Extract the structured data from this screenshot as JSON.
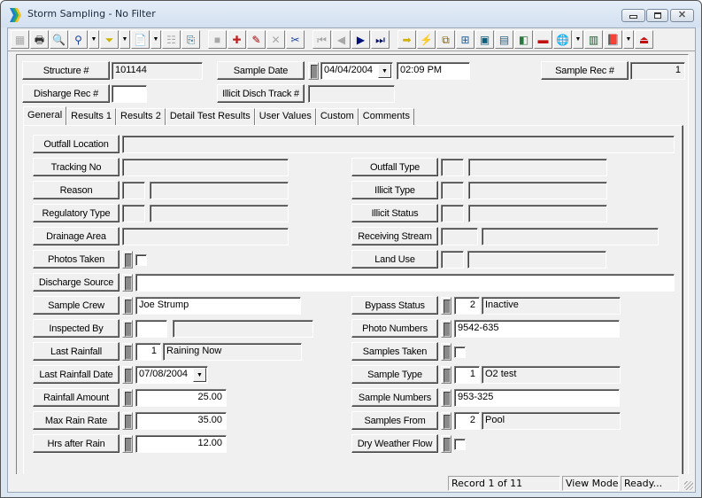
{
  "window": {
    "title": "Storm Sampling - No Filter",
    "buttons": {
      "minimize": "minimize",
      "maximize": "maximize",
      "close": "✕"
    }
  },
  "toolbar": {
    "items": [
      {
        "icon": "form-view-icon",
        "glyph": "▦",
        "disabled": true
      },
      {
        "icon": "print-icon",
        "glyph": "🖶"
      },
      {
        "icon": "print-preview-icon",
        "glyph": "🔍"
      },
      {
        "icon": "find-binoculars-icon",
        "glyph": "⚲"
      },
      {
        "icon": "find-dropdown-icon",
        "glyph": "▼",
        "dropdown": true
      },
      {
        "icon": "filter-funnel-icon",
        "glyph": "⏷"
      },
      {
        "icon": "filter-dropdown-icon",
        "glyph": "▼",
        "dropdown": true
      },
      {
        "icon": "report-icon",
        "glyph": "📄"
      },
      {
        "icon": "report-dropdown-icon",
        "glyph": "▼",
        "dropdown": true
      },
      {
        "icon": "properties-icon",
        "glyph": "☷",
        "disabled": true
      },
      {
        "icon": "copy-record-icon",
        "glyph": "⎘"
      },
      {
        "icon": "save-icon",
        "glyph": "■",
        "disabled": true
      },
      {
        "icon": "add-record-icon",
        "glyph": "✚"
      },
      {
        "icon": "edit-pencil-icon",
        "glyph": "✎"
      },
      {
        "icon": "delete-icon",
        "glyph": "✕",
        "disabled": true
      },
      {
        "icon": "cut-scissors-icon",
        "glyph": "✂"
      },
      {
        "icon": "first-record-icon",
        "glyph": "⏮",
        "disabled": true
      },
      {
        "icon": "previous-record-icon",
        "glyph": "◀",
        "disabled": true
      },
      {
        "icon": "next-record-icon",
        "glyph": "▶"
      },
      {
        "icon": "last-record-icon",
        "glyph": "⏭"
      },
      {
        "icon": "goto-arrow-icon",
        "glyph": "➡"
      },
      {
        "icon": "lightning-icon",
        "glyph": "⚡"
      },
      {
        "icon": "related-records-icon",
        "glyph": "⧉"
      },
      {
        "icon": "link-icon",
        "glyph": "⊞"
      },
      {
        "icon": "map-icon",
        "glyph": "▣"
      },
      {
        "icon": "calculator-icon",
        "glyph": "▤"
      },
      {
        "icon": "gis-icon",
        "glyph": "◧"
      },
      {
        "icon": "toolbox-icon",
        "glyph": "▬"
      },
      {
        "icon": "globe-search-icon",
        "glyph": "🌐"
      },
      {
        "icon": "globe-dropdown-icon",
        "glyph": "▼",
        "dropdown": true
      },
      {
        "icon": "spreadsheet-icon",
        "glyph": "▥"
      },
      {
        "icon": "help-book-icon",
        "glyph": "📕"
      },
      {
        "icon": "help-dropdown-icon",
        "glyph": "▼",
        "dropdown": true
      },
      {
        "icon": "exit-icon",
        "glyph": "⏏"
      }
    ]
  },
  "header": {
    "structure_label": "Structure #",
    "structure_value": "101144",
    "sample_date_label": "Sample Date",
    "sample_date_value": "04/04/2004",
    "sample_time_value": "02:09 PM",
    "sample_rec_label": "Sample Rec #",
    "sample_rec_value": "1",
    "discharge_rec_label": "Disharge Rec #",
    "discharge_rec_value": "",
    "illicit_track_label": "Illicit Disch Track #",
    "illicit_track_value": ""
  },
  "tabs": [
    {
      "label": "General",
      "active": true
    },
    {
      "label": "Results 1"
    },
    {
      "label": "Results 2"
    },
    {
      "label": "Detail Test Results"
    },
    {
      "label": "User Values"
    },
    {
      "label": "Custom"
    },
    {
      "label": "Comments"
    }
  ],
  "general": {
    "outfall_location": {
      "label": "Outfall Location",
      "value": ""
    },
    "tracking_no": {
      "label": "Tracking No",
      "value": ""
    },
    "reason": {
      "label": "Reason",
      "code": "",
      "value": ""
    },
    "regulatory_type": {
      "label": "Regulatory Type",
      "code": "",
      "value": ""
    },
    "drainage_area": {
      "label": "Drainage Area",
      "value": ""
    },
    "photos_taken": {
      "label": "Photos Taken",
      "checked": false
    },
    "discharge_source": {
      "label": "Discharge Source",
      "value": ""
    },
    "sample_crew": {
      "label": "Sample Crew",
      "value": "Joe Strump"
    },
    "inspected_by": {
      "label": "Inspected By",
      "code": "",
      "value": ""
    },
    "last_rainfall": {
      "label": "Last Rainfall",
      "code": "1",
      "value": "Raining Now"
    },
    "last_rainfall_date": {
      "label": "Last Rainfall Date",
      "value": "07/08/2004"
    },
    "rainfall_amount": {
      "label": "Rainfall Amount",
      "value": "25.00"
    },
    "max_rain_rate": {
      "label": "Max Rain Rate",
      "value": "35.00"
    },
    "hrs_after_rain": {
      "label": "Hrs after Rain",
      "value": "12.00"
    },
    "outfall_type": {
      "label": "Outfall Type",
      "code": "",
      "value": ""
    },
    "illicit_type": {
      "label": "Illicit Type",
      "code": "",
      "value": ""
    },
    "illicit_status": {
      "label": "Illicit Status",
      "code": "",
      "value": ""
    },
    "receiving_stream": {
      "label": "Receiving Stream",
      "code": "",
      "value": ""
    },
    "land_use": {
      "label": "Land Use",
      "code": "",
      "value": ""
    },
    "bypass_status": {
      "label": "Bypass Status",
      "code": "2",
      "value": "Inactive"
    },
    "photo_numbers": {
      "label": "Photo Numbers",
      "value": "9542-635"
    },
    "samples_taken": {
      "label": "Samples Taken",
      "checked": false
    },
    "sample_type": {
      "label": "Sample Type",
      "code": "1",
      "value": "O2 test"
    },
    "sample_numbers": {
      "label": "Sample Numbers",
      "value": "953-325"
    },
    "samples_from": {
      "label": "Samples From",
      "code": "2",
      "value": "Pool"
    },
    "dry_weather_flow": {
      "label": "Dry Weather Flow",
      "checked": false
    }
  },
  "status": {
    "record": "Record 1 of 11",
    "mode": "View Mode",
    "state": "Ready..."
  }
}
